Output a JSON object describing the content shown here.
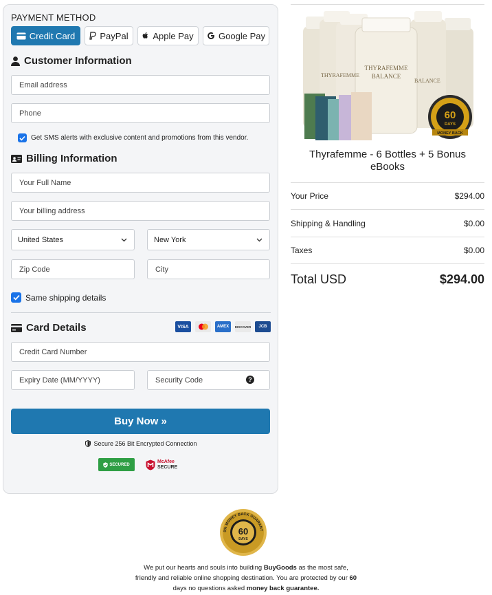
{
  "payment_method": {
    "title": "PAYMENT METHOD",
    "options": [
      {
        "label": "Credit Card",
        "active": true
      },
      {
        "label": "PayPal",
        "active": false
      },
      {
        "label": "Apple Pay",
        "active": false
      },
      {
        "label": "Google Pay",
        "active": false
      }
    ]
  },
  "customer": {
    "heading": "Customer Information",
    "email_placeholder": "Email address",
    "phone_placeholder": "Phone",
    "sms_checked": true,
    "sms_label": "Get SMS alerts with exclusive content and promotions from this vendor."
  },
  "billing": {
    "heading": "Billing Information",
    "name_placeholder": "Your Full Name",
    "address_placeholder": "Your billing address",
    "country": "United States",
    "state": "New York",
    "zip_placeholder": "Zip Code",
    "city_placeholder": "City",
    "same_shipping_checked": true,
    "same_shipping_label": "Same shipping details"
  },
  "card": {
    "heading": "Card Details",
    "logos": [
      "VISA",
      "mastercard",
      "AMEX",
      "DISCOVER",
      "JCB"
    ],
    "number_placeholder": "Credit Card Number",
    "expiry_placeholder": "Expiry Date (MM/YYYY)",
    "cvv_placeholder": "Security Code"
  },
  "buy_button": "Buy Now »",
  "secure_text": "Secure 256 Bit Encrypted Connection",
  "trust_badges": {
    "secured": "SECURED",
    "mcafee_line1": "McAfee",
    "mcafee_line2": "SECURE"
  },
  "summary": {
    "product_name": "Thyrafemme - 6 Bottles + 5 Bonus eBooks",
    "product_bottle_label_1": "THYRAFEMME",
    "product_bottle_label_2": "BALANCE",
    "seal_days": "60",
    "seal_word": "DAYS",
    "seal_caption": "MONEY BACK",
    "rows": [
      {
        "label": "Your Price",
        "value": "$294.00"
      },
      {
        "label": "Shipping & Handling",
        "value": "$0.00"
      },
      {
        "label": "Taxes",
        "value": "$0.00"
      }
    ],
    "total_label": "Total USD",
    "total_value": "$294.00"
  },
  "footer": {
    "seal_days": "60",
    "seal_word": "DAYS",
    "seal_ring": "100% MONEY BACK GUARANTEE",
    "line1_prefix": "We put our hearts and souls into building ",
    "brand": "BuyGoods",
    "line1_suffix": " as the most safe,",
    "line2_prefix": "friendly and reliable online shopping destination. You are protected by our ",
    "days": "60",
    "line3_prefix": "days no questions asked ",
    "guarantee": "money back guarantee."
  },
  "colors": {
    "primary": "#1f78b0",
    "checkbox": "#1a73e8",
    "card_bg": "#f4f5f7",
    "seal_gold": "#d4a017"
  }
}
